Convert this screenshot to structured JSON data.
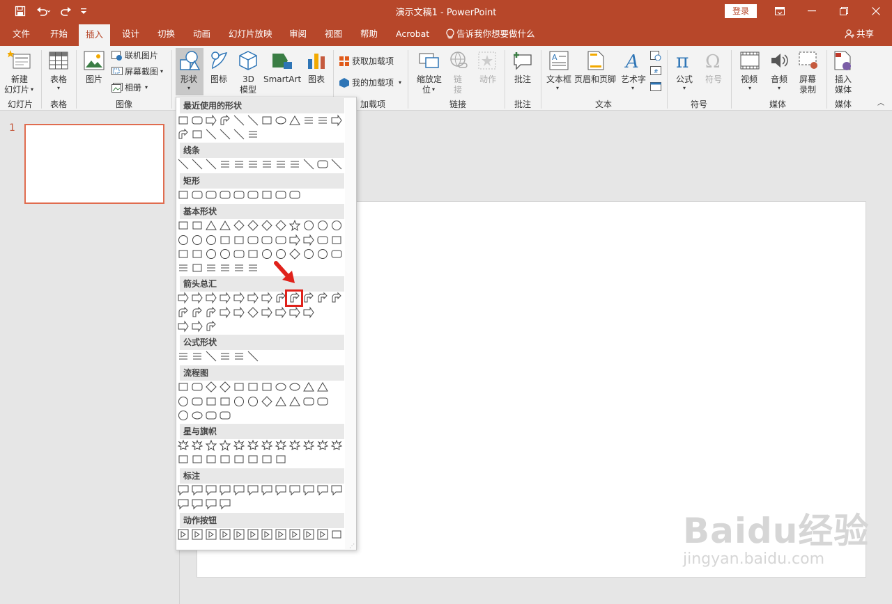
{
  "title_bar": {
    "document_title": "演示文稿1  -  PowerPoint",
    "login_label": "登录",
    "qat": {
      "save_icon": "save-icon",
      "undo_icon": "undo-icon",
      "redo_icon": "redo-icon",
      "customize_icon": "customize-qat-icon"
    },
    "window_buttons": [
      "ribbon-display-icon",
      "minimize-icon",
      "restore-icon",
      "close-icon"
    ]
  },
  "tabs": [
    "文件",
    "开始",
    "插入",
    "设计",
    "切换",
    "动画",
    "幻灯片放映",
    "审阅",
    "视图",
    "帮助",
    "Acrobat"
  ],
  "active_tab": "插入",
  "tell_me": "告诉我你想要做什么",
  "share_label": "共享",
  "ribbon": {
    "new_slide": [
      "新建",
      "幻灯片"
    ],
    "table": "表格",
    "picture": "图片",
    "online_picture": "联机图片",
    "screenshot": "屏幕截图",
    "album": "相册",
    "shapes": "形状",
    "icons": "图标",
    "model_3d": [
      "3D",
      "模型"
    ],
    "smartart": "SmartArt",
    "chart": "图表",
    "get_addins": "获取加载项",
    "my_addins": "我的加载项",
    "zoom": [
      "缩放定",
      "位"
    ],
    "link": [
      "链",
      "接"
    ],
    "action": "动作",
    "comment": "批注",
    "textbox": "文本框",
    "header_footer": "页眉和页脚",
    "wordart": "艺术字",
    "equation": "公式",
    "symbol": "符号",
    "video": "视频",
    "audio": "音频",
    "screen_record": [
      "屏幕",
      "录制"
    ],
    "insert_media": [
      "插入",
      "媒体"
    ]
  },
  "groups": [
    "幻灯片",
    "表格",
    "图像",
    "加载项",
    "链接",
    "批注",
    "文本",
    "符号",
    "媒体",
    "媒体"
  ],
  "shape_menu": {
    "sections": [
      "最近使用的形状",
      "线条",
      "矩形",
      "基本形状",
      "箭头总汇",
      "公式形状",
      "流程图",
      "星与旗帜",
      "标注",
      "动作按钮"
    ],
    "highlighted_shape": "bent-arrow"
  },
  "slides": {
    "current_number": "1"
  },
  "watermark": {
    "main": "Baidu经验",
    "sub": "jingyan.baidu.com"
  },
  "colors": {
    "accent": "#b7472a",
    "highlight": "#e0221b",
    "thumb_border": "#e06c4f"
  }
}
